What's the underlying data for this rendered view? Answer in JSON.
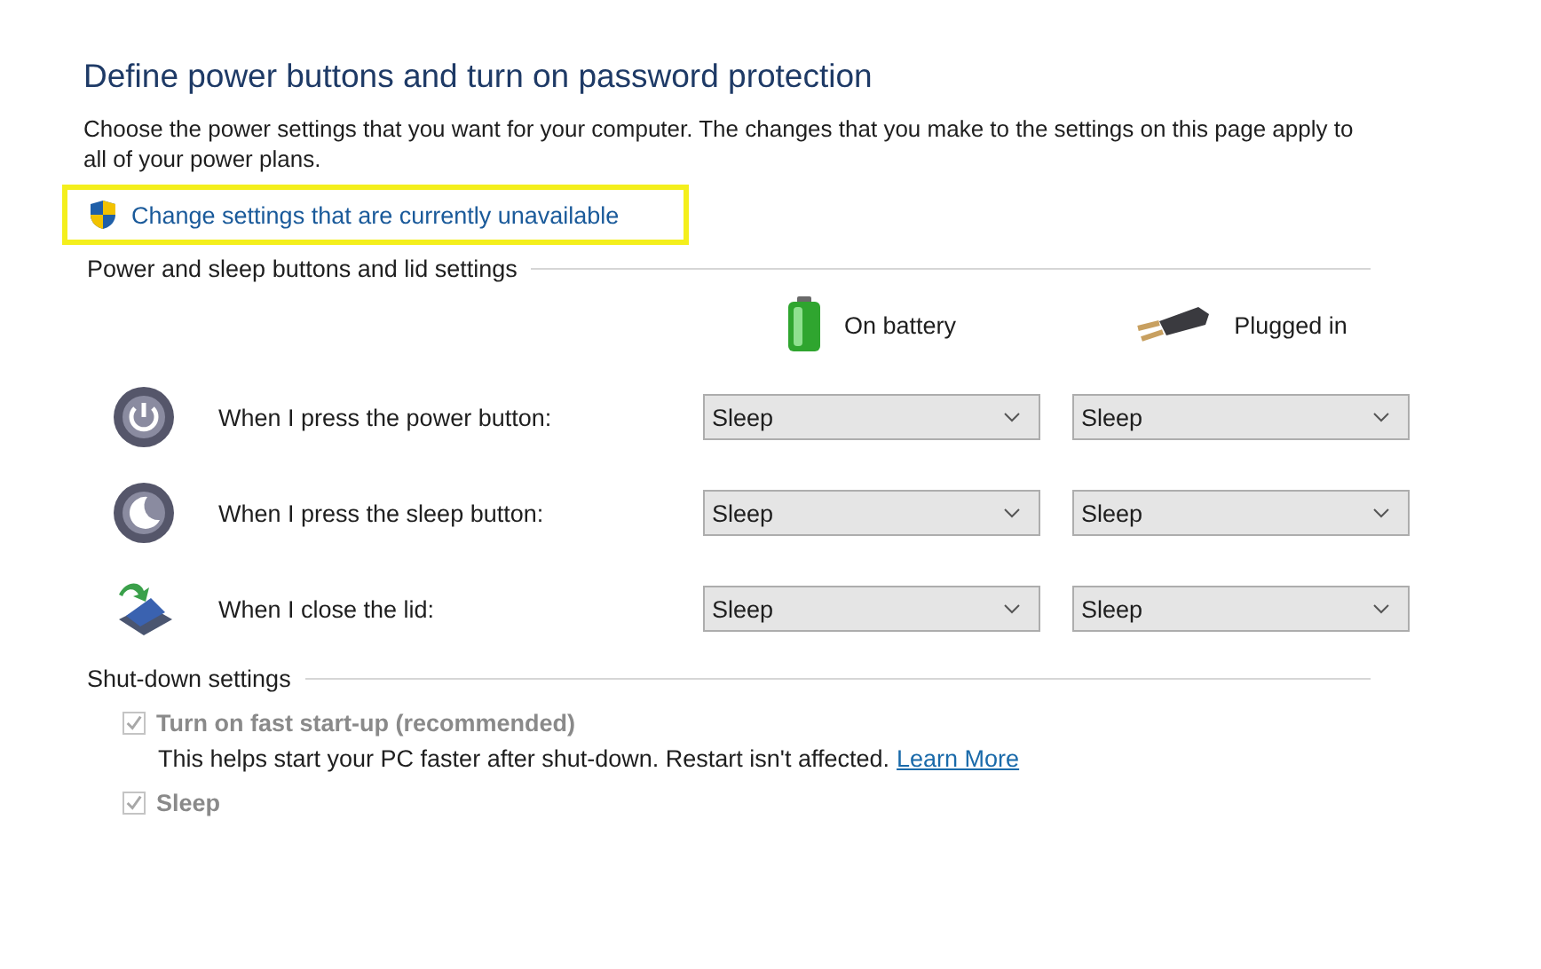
{
  "title": "Define power buttons and turn on password protection",
  "description": "Choose the power settings that you want for your computer. The changes that you make to the settings on this page apply to all of your power plans.",
  "admin_link": {
    "label": "Change settings that are currently unavailable",
    "highlighted": true
  },
  "buttons_section": {
    "heading": "Power and sleep buttons and lid settings",
    "columns": [
      {
        "kind": "battery",
        "label": "On battery"
      },
      {
        "kind": "plug",
        "label": "Plugged in"
      }
    ],
    "rows": [
      {
        "kind": "power",
        "label": "When I press the power button:",
        "values": [
          "Sleep",
          "Sleep"
        ]
      },
      {
        "kind": "sleep",
        "label": "When I press the sleep button:",
        "values": [
          "Sleep",
          "Sleep"
        ]
      },
      {
        "kind": "lid",
        "label": "When I close the lid:",
        "values": [
          "Sleep",
          "Sleep"
        ]
      }
    ]
  },
  "shutdown_section": {
    "heading": "Shut-down settings",
    "options": [
      {
        "label": "Turn on fast start-up (recommended)",
        "checked": true,
        "disabled": true,
        "description": "This helps start your PC faster after shut-down. Restart isn't affected.",
        "link": "Learn More"
      },
      {
        "label": "Sleep",
        "checked": true,
        "disabled": true
      }
    ]
  }
}
